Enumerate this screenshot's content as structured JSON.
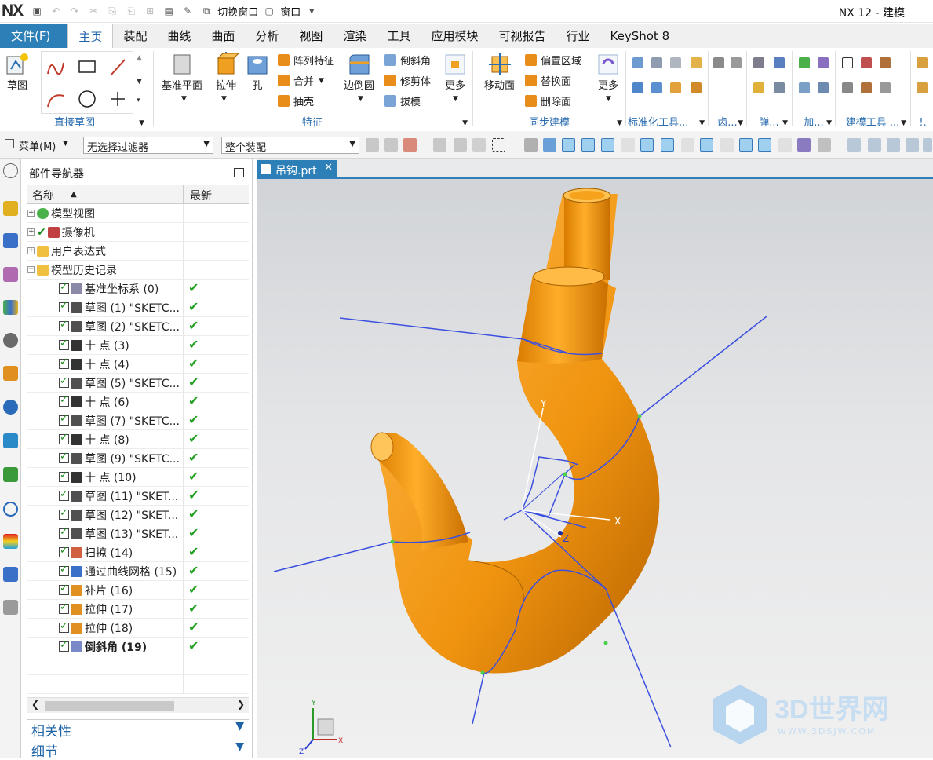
{
  "titlebar": {
    "logo": "NX",
    "switch_window": "切换窗口",
    "window_menu": "窗口",
    "app_title": "NX 12 - 建模"
  },
  "menu_tabs": [
    "文件(F)",
    "主页",
    "装配",
    "曲线",
    "曲面",
    "分析",
    "视图",
    "渲染",
    "工具",
    "应用模块",
    "可视报告",
    "行业",
    "KeyShot 8"
  ],
  "ribbon": {
    "sketch_label": "草图",
    "direct_sketch_group": "直接草图",
    "datum_plane": "基准平面",
    "extrude": "拉伸",
    "hole": "孔",
    "pattern_feature": "阵列特征",
    "unite": "合并",
    "shell": "抽壳",
    "edge_blend": "边倒圆",
    "chamfer": "倒斜角",
    "trim_body": "修剪体",
    "draft": "拔模",
    "more": "更多",
    "feature_group": "特征",
    "move_face": "移动面",
    "offset_region": "偏置区域",
    "replace_face": "替换面",
    "delete_face": "删除面",
    "sync_modeling_group": "同步建模",
    "std_tools_group": "标准化工具...",
    "gear_group": "齿...",
    "spring_group": "弹...",
    "add_group": "加...",
    "modeling_tools_group": "建模工具 ...",
    "overflow_group": "!."
  },
  "toolbar": {
    "menu": "菜单(M)",
    "filter_value": "无选择过滤器",
    "scope_value": "整个装配"
  },
  "navigator": {
    "title": "部件导航器",
    "col_name": "名称",
    "col_latest": "最新",
    "top_nodes": [
      {
        "label": "模型视图"
      },
      {
        "label": "摄像机"
      },
      {
        "label": "用户表达式"
      },
      {
        "label": "模型历史记录"
      }
    ],
    "history": [
      {
        "label": "基准坐标系 (0)",
        "latest": "✔"
      },
      {
        "label": "草图 (1) \"SKETC...",
        "latest": "✔"
      },
      {
        "label": "草图 (2) \"SKETC...",
        "latest": "✔"
      },
      {
        "label": "十 点 (3)",
        "latest": "✔"
      },
      {
        "label": "十 点 (4)",
        "latest": "✔"
      },
      {
        "label": "草图 (5) \"SKETC...",
        "latest": "✔"
      },
      {
        "label": "十 点 (6)",
        "latest": "✔"
      },
      {
        "label": "草图 (7) \"SKETC...",
        "latest": "✔"
      },
      {
        "label": "十 点 (8)",
        "latest": "✔"
      },
      {
        "label": "草图 (9) \"SKETC...",
        "latest": "✔"
      },
      {
        "label": "十 点 (10)",
        "latest": "✔"
      },
      {
        "label": "草图 (11) \"SKET...",
        "latest": "✔"
      },
      {
        "label": "草图 (12) \"SKET...",
        "latest": "✔"
      },
      {
        "label": "草图 (13) \"SKET...",
        "latest": "✔"
      },
      {
        "label": "扫掠 (14)",
        "latest": "✔"
      },
      {
        "label": "通过曲线网格 (15)",
        "latest": "✔"
      },
      {
        "label": "补片 (16)",
        "latest": "✔"
      },
      {
        "label": "拉伸 (17)",
        "latest": "✔"
      },
      {
        "label": "拉伸 (18)",
        "latest": "✔"
      },
      {
        "label": "倒斜角 (19)",
        "latest": "✔"
      }
    ],
    "dependencies": "相关性",
    "details": "细节"
  },
  "viewport": {
    "tab_label": "吊钩.prt",
    "axis_x": "X",
    "axis_y": "Y",
    "axis_z": "Z",
    "watermark_main": "3D世界网",
    "watermark_url": "WWW.3DSJW.COM"
  },
  "colors": {
    "accent": "#2d7fb7",
    "model_orange": "#f29a10",
    "curve_blue": "#3b4fe0"
  }
}
